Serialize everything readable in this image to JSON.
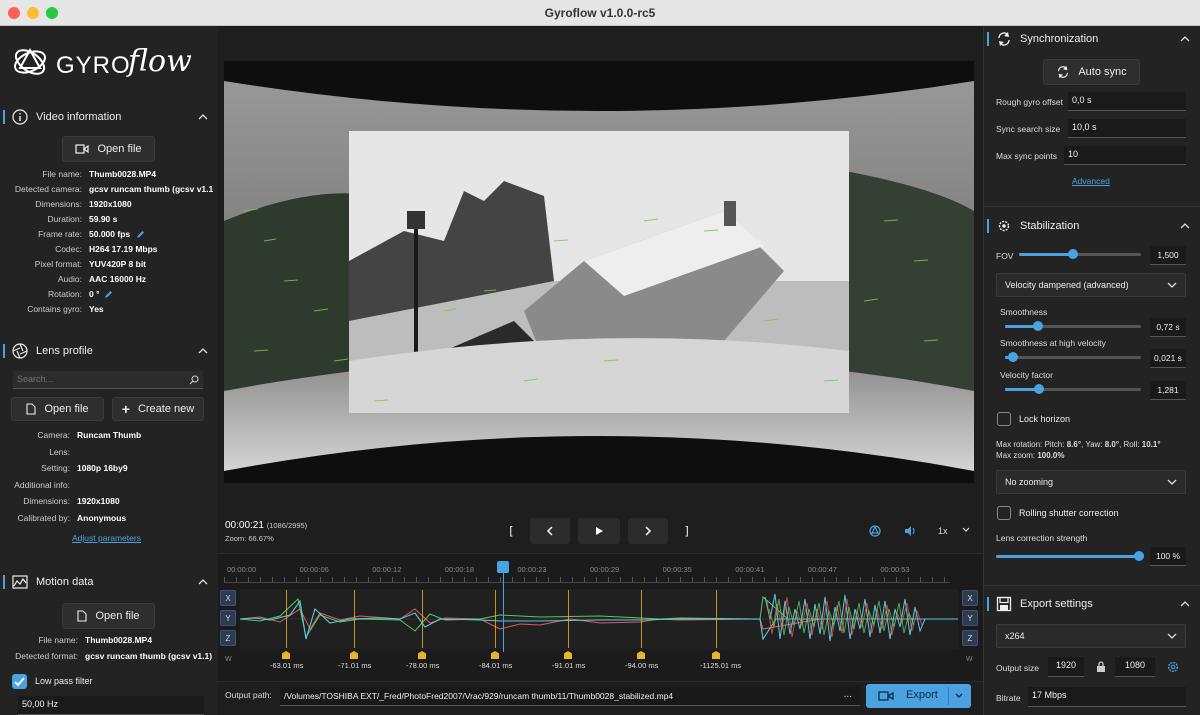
{
  "window": {
    "title": "Gyroflow v1.0.0-rc5"
  },
  "colors": {
    "accent": "#4aa3e0",
    "marker": "#e8b524",
    "panel": "#232323"
  },
  "logo": {
    "text_gyro": "GYRO",
    "text_flow": "flow"
  },
  "video_info": {
    "title": "Video information",
    "open_file": "Open file",
    "rows": [
      {
        "label": "File name:",
        "value": "Thumb0028.MP4"
      },
      {
        "label": "Detected camera:",
        "value": "gcsv runcam thumb (gcsv v1.1"
      },
      {
        "label": "Dimensions:",
        "value": "1920x1080"
      },
      {
        "label": "Duration:",
        "value": "59.90 s"
      },
      {
        "label": "Frame rate:",
        "value": "50.000 fps"
      },
      {
        "label": "Codec:",
        "value": "H264 17.19 Mbps"
      },
      {
        "label": "Pixel format:",
        "value": "YUV420P 8 bit"
      },
      {
        "label": "Audio:",
        "value": "AAC 16000 Hz"
      },
      {
        "label": "Rotation:",
        "value": "0 °"
      },
      {
        "label": "Contains gyro:",
        "value": "Yes"
      }
    ]
  },
  "lens_profile": {
    "title": "Lens profile",
    "search_placeholder": "Search...",
    "open_file": "Open file",
    "create_new": "Create new",
    "rows": [
      {
        "label": "Camera:",
        "value": "Runcam Thumb"
      },
      {
        "label": "Lens:",
        "value": ""
      },
      {
        "label": "Setting:",
        "value": "1080p 16by9"
      },
      {
        "label": "Additional info:",
        "value": ""
      },
      {
        "label": "Dimensions:",
        "value": "1920x1080"
      },
      {
        "label": "Calibrated by:",
        "value": "Anonymous"
      }
    ],
    "adjust_link": "Adjust parameters"
  },
  "motion_data": {
    "title": "Motion data",
    "open_file": "Open file",
    "rows": [
      {
        "label": "File name:",
        "value": "Thumb0028.MP4"
      },
      {
        "label": "Detected format:",
        "value": "gcsv runcam thumb (gcsv v1.1)"
      }
    ],
    "low_pass_label": "Low pass filter",
    "low_pass_value": "50,00 Hz"
  },
  "playback": {
    "time": "00:00:21",
    "frame": "(1086/2995)",
    "zoom": "Zoom: 66.67%",
    "speed": "1x"
  },
  "timeline": {
    "ticks": [
      "00:00:00",
      "00:00:06",
      "00:00:12",
      "00:00:18",
      "00:00:23",
      "00:00:29",
      "00:00:35",
      "00:00:41",
      "00:00:47",
      "00:00:53"
    ],
    "markers": [
      "-63.01 ms",
      "-71.01 ms",
      "-78.00 ms",
      "-84.01 ms",
      "-91.01 ms",
      "-94.00 ms",
      "-1125.01 ms"
    ],
    "axis_left": [
      "X",
      "Y",
      "Z"
    ],
    "axis_right": [
      "X",
      "Y",
      "Z"
    ],
    "w_label": "W"
  },
  "export_bar": {
    "label": "Output path:",
    "path": "/Volumes/TOSHIBA EXT/_Fred/PhotoFred2007/Vrac/929/runcam thumb/11/Thumb0028_stabilized.mp4",
    "more": "...",
    "export": "Export"
  },
  "sync": {
    "title": "Synchronization",
    "auto_sync": "Auto sync",
    "rough_label": "Rough gyro offset",
    "rough_value": "0,0 s",
    "search_label": "Sync search size",
    "search_value": "10,0 s",
    "max_label": "Max sync points",
    "max_value": "10",
    "advanced": "Advanced"
  },
  "stabilization": {
    "title": "Stabilization",
    "fov_label": "FOV",
    "fov_value": "1,500",
    "fov_level": 0.44,
    "method": "Velocity dampened (advanced)",
    "smoothness_label": "Smoothness",
    "smoothness_value": "0,72 s",
    "smoothness_level": 0.24,
    "smooth_hv_label": "Smoothness at high velocity",
    "smooth_hv_value": "0,021 s",
    "smooth_hv_level": 0.06,
    "vel_factor_label": "Velocity factor",
    "vel_factor_value": "1,281",
    "vel_factor_level": 0.25,
    "lock_horizon": "Lock horizon",
    "max_rotation_prefix": "Max rotation: Pitch: ",
    "pitch": "8.6°",
    "yaw_prefix": ", Yaw: ",
    "yaw": "8.0°",
    "roll_prefix": ", Roll: ",
    "roll": "10.1°",
    "max_zoom_prefix": "Max zoom: ",
    "max_zoom": "100.0%",
    "zoom_mode": "No zooming",
    "rolling_shutter": "Rolling shutter correction",
    "lens_strength_label": "Lens correction strength",
    "lens_strength_value": "100 %",
    "lens_strength_level": 1.0
  },
  "export_settings": {
    "title": "Export settings",
    "codec": "x264",
    "size_label": "Output size",
    "width": "1920",
    "height": "1080",
    "bitrate_label": "Bitrate",
    "bitrate_value": "17 Mbps"
  }
}
